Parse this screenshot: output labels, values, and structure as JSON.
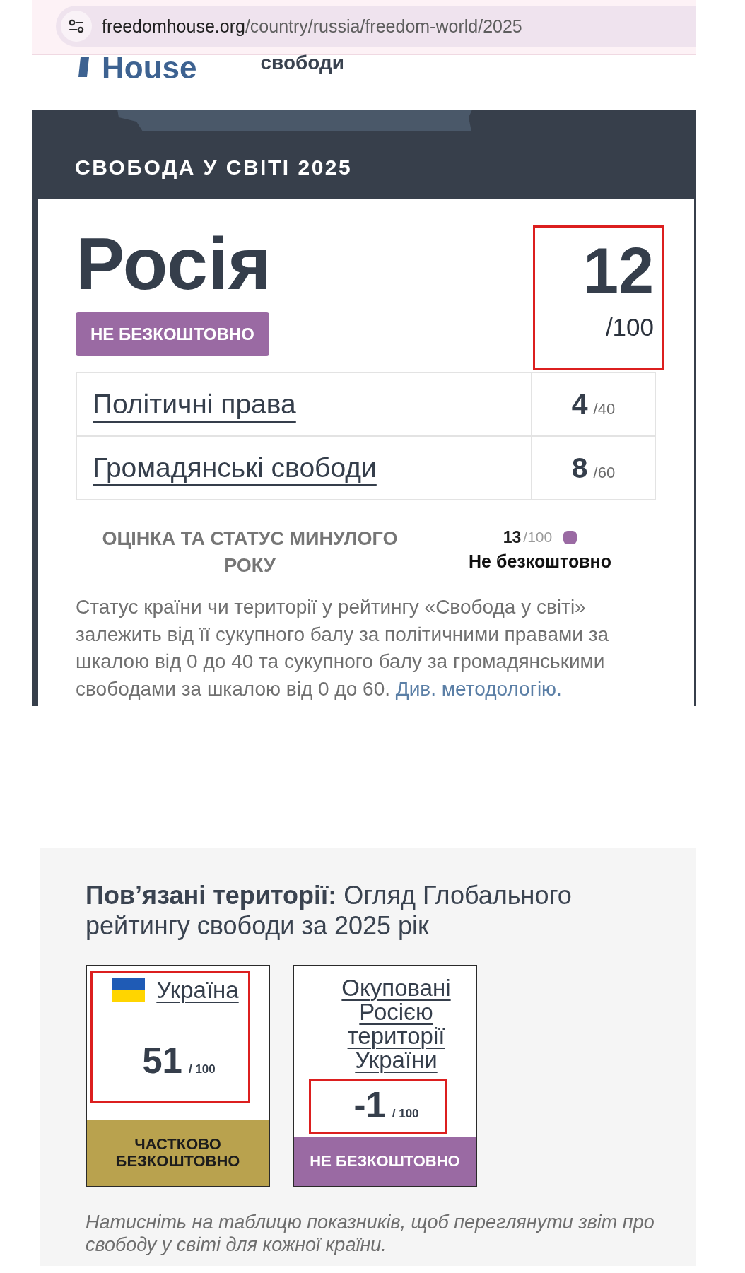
{
  "browser": {
    "url_domain": "freedomhouse.org",
    "url_path": "/country/russia/freedom-world/2025"
  },
  "header": {
    "logo_text": "House",
    "tagline": "свободи"
  },
  "report": {
    "title": "СВОБОДА У СВІТІ 2025",
    "country": "Росія",
    "status": {
      "label": "НЕ БЕЗКОШТОВНО",
      "kind": "not_free"
    },
    "total_score": {
      "value": "12",
      "max": "/100",
      "highlighted": true
    },
    "categories": [
      {
        "label": "Політичні права",
        "score": "4",
        "max": "/40"
      },
      {
        "label": "Громадянські свободи",
        "score": "8",
        "max": "/60"
      }
    ],
    "previous_year": {
      "heading": "ОЦІНКА ТА СТАТУС МИНУЛОГО РОКУ",
      "score": "13",
      "max": "/100",
      "status": {
        "label": "Не безкоштовно",
        "kind": "not_free"
      }
    },
    "description": "Статус країни чи території у рейтингу «Свобода у світі» залежить від її сукупного балу за політичними правами за шкалою від 0 до 40 та сукупного балу за громадянськими свободами за шкалою від 0 до 60.",
    "methodology_link": "Див. методологію."
  },
  "related": {
    "heading": "**Пов’язані території:** Огляд Глобального рейтингу свободи за 2025 рік",
    "territories": [
      {
        "name": "Україна",
        "flag": true,
        "score": "51",
        "max": "/ 100",
        "name_highlighted": true,
        "score_highlighted": true,
        "status": {
          "label": "ЧАСТКОВО БЕЗКОШТОВНО",
          "kind": "partly_free"
        }
      },
      {
        "name": "Окуповані Росією території України",
        "flag": false,
        "score": "-1",
        "max": "/ 100",
        "name_highlighted": false,
        "score_highlighted": true,
        "status": {
          "label": "НЕ БЕЗКОШТОВНО",
          "kind": "not_free"
        }
      }
    ],
    "caption": "Натисніть на таблицю показників, щоб переглянути звіт про свободу у світі для кожної країни."
  }
}
